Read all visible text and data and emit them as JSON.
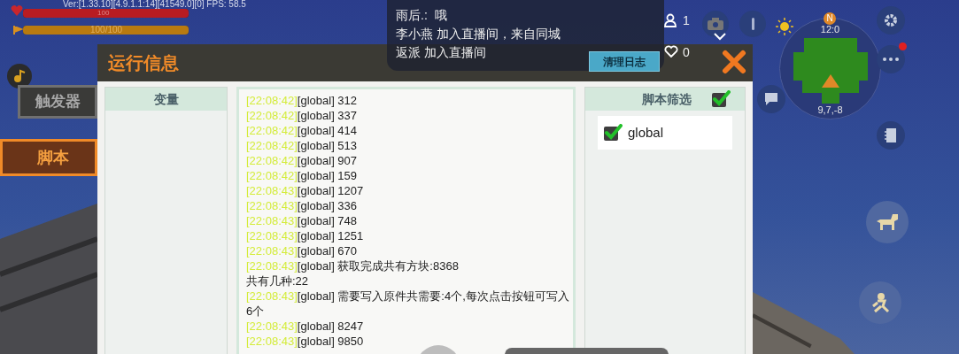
{
  "hud": {
    "version": "Ver:[1.33.10][4.9.1.1:14][41549.0][0] FPS: 58.5",
    "health": {
      "reading": "100",
      "level": 1
    },
    "hunger": {
      "reading": "100/100",
      "level": 1
    }
  },
  "side_tabs": [
    {
      "label": "触发器",
      "selected": false
    },
    {
      "label": "脚本",
      "selected": true
    }
  ],
  "dialog": {
    "title": "运行信息",
    "clear_button": "清理日志",
    "variables": {
      "heading": "变量"
    },
    "log": [
      {
        "time": "[22:08:42]",
        "text": "[global] 312"
      },
      {
        "time": "[22:08:42]",
        "text": "[global] 337"
      },
      {
        "time": "[22:08:42]",
        "text": "[global] 414"
      },
      {
        "time": "[22:08:42]",
        "text": "[global] 513"
      },
      {
        "time": "[22:08:42]",
        "text": "[global] 907"
      },
      {
        "time": "[22:08:42]",
        "text": "[global] 159"
      },
      {
        "time": "[22:08:43]",
        "text": "[global] 1207"
      },
      {
        "time": "[22:08:43]",
        "text": "[global] 336"
      },
      {
        "time": "[22:08:43]",
        "text": "[global] 748"
      },
      {
        "time": "[22:08:43]",
        "text": "[global] 1251"
      },
      {
        "time": "[22:08:43]",
        "text": "[global] 670"
      },
      {
        "time": "[22:08:43]",
        "text": "[global] 获取完成共有方块:8368\n共有几种:22"
      },
      {
        "time": "[22:08:43]",
        "text": "[global] 需要写入原件共需要:4个,每次点击按钮可写入\n6个"
      },
      {
        "time": "[22:08:43]",
        "text": "[global] 8247"
      },
      {
        "time": "[22:08:43]",
        "text": "[global] 9850"
      }
    ],
    "filter": {
      "heading": "脚本筛选",
      "all_checked": true,
      "scripts": [
        {
          "label": "global",
          "checked": true
        }
      ]
    }
  },
  "live_chat": {
    "messages": [
      "雨后.:  哦",
      "李小燕 加入直播间，来自同城",
      "返派 加入直播间"
    ],
    "viewers": "1",
    "likes": "0"
  },
  "minimap": {
    "compass": "N",
    "time": "12:0",
    "coords": "9,7,-8"
  },
  "menu_badge": true
}
